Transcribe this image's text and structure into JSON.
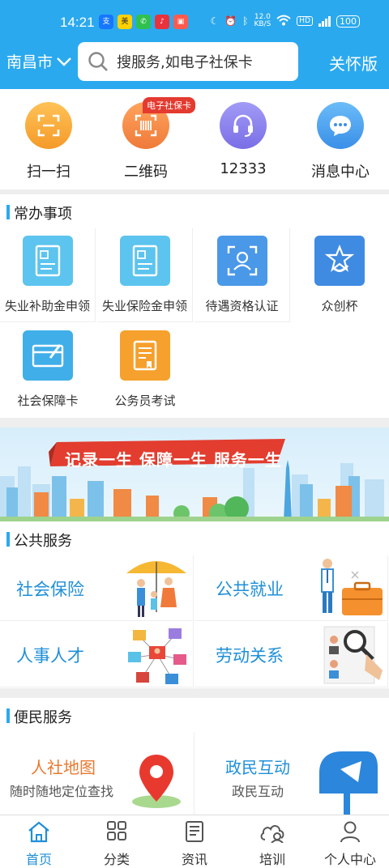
{
  "status": {
    "time": "14:21",
    "net_speed": "12.0\nKB/S",
    "battery": "100",
    "signal": "5G"
  },
  "header": {
    "city": "南昌市",
    "search_placeholder": "搜服务,如电子社保卡",
    "care_mode": "关怀版"
  },
  "quick": [
    {
      "label": "扫一扫",
      "icon": "scan-icon",
      "color": "#f6a53b"
    },
    {
      "label": "二维码",
      "icon": "qrcode-icon",
      "color": "#f28a4b",
      "badge": "电子社保卡"
    },
    {
      "label": "12333",
      "icon": "headset-icon",
      "color": "#8d83ee"
    },
    {
      "label": "消息中心",
      "icon": "message-icon",
      "color": "#4aa5f2"
    }
  ],
  "common_section": {
    "title": "常办事项"
  },
  "common": [
    {
      "label": "失业补助金申领",
      "icon": "document-icon",
      "color": "#5cc4ee"
    },
    {
      "label": "失业保险金申领",
      "icon": "document-icon",
      "color": "#5cc4ee"
    },
    {
      "label": "待遇资格认证",
      "icon": "face-scan-icon",
      "color": "#4a98e8"
    },
    {
      "label": "众创杯",
      "icon": "trophy-icon",
      "color": "#3f8be2"
    },
    {
      "label": "社会保障卡",
      "icon": "card-icon",
      "color": "#40aee8"
    },
    {
      "label": "公务员考试",
      "icon": "exam-icon",
      "color": "#f6a02d"
    }
  ],
  "banner": {
    "slogan": "记录一生 保障一生 服务一生"
  },
  "public_section": {
    "title": "公共服务"
  },
  "public": [
    {
      "label": "社会保险",
      "icon": "family-umbrella-icon"
    },
    {
      "label": "公共就业",
      "icon": "briefcase-icon"
    },
    {
      "label": "人事人才",
      "icon": "network-icon"
    },
    {
      "label": "劳动关系",
      "icon": "magnifier-icon"
    }
  ],
  "convenience_section": {
    "title": "便民服务"
  },
  "convenience": [
    {
      "title": "人社地图",
      "subtitle": "随时随地定位查找",
      "icon": "map-pin-icon",
      "color": "#e8792f"
    },
    {
      "title": "政民互动",
      "subtitle": "政民互动",
      "icon": "mailbox-icon",
      "color": "#1f8fd8"
    }
  ],
  "tabs": [
    {
      "label": "首页",
      "icon": "home-icon",
      "active": true
    },
    {
      "label": "分类",
      "icon": "grid-icon",
      "active": false
    },
    {
      "label": "资讯",
      "icon": "news-icon",
      "active": false
    },
    {
      "label": "培训",
      "icon": "training-icon",
      "active": false
    },
    {
      "label": "个人中心",
      "icon": "person-icon",
      "active": false
    }
  ]
}
